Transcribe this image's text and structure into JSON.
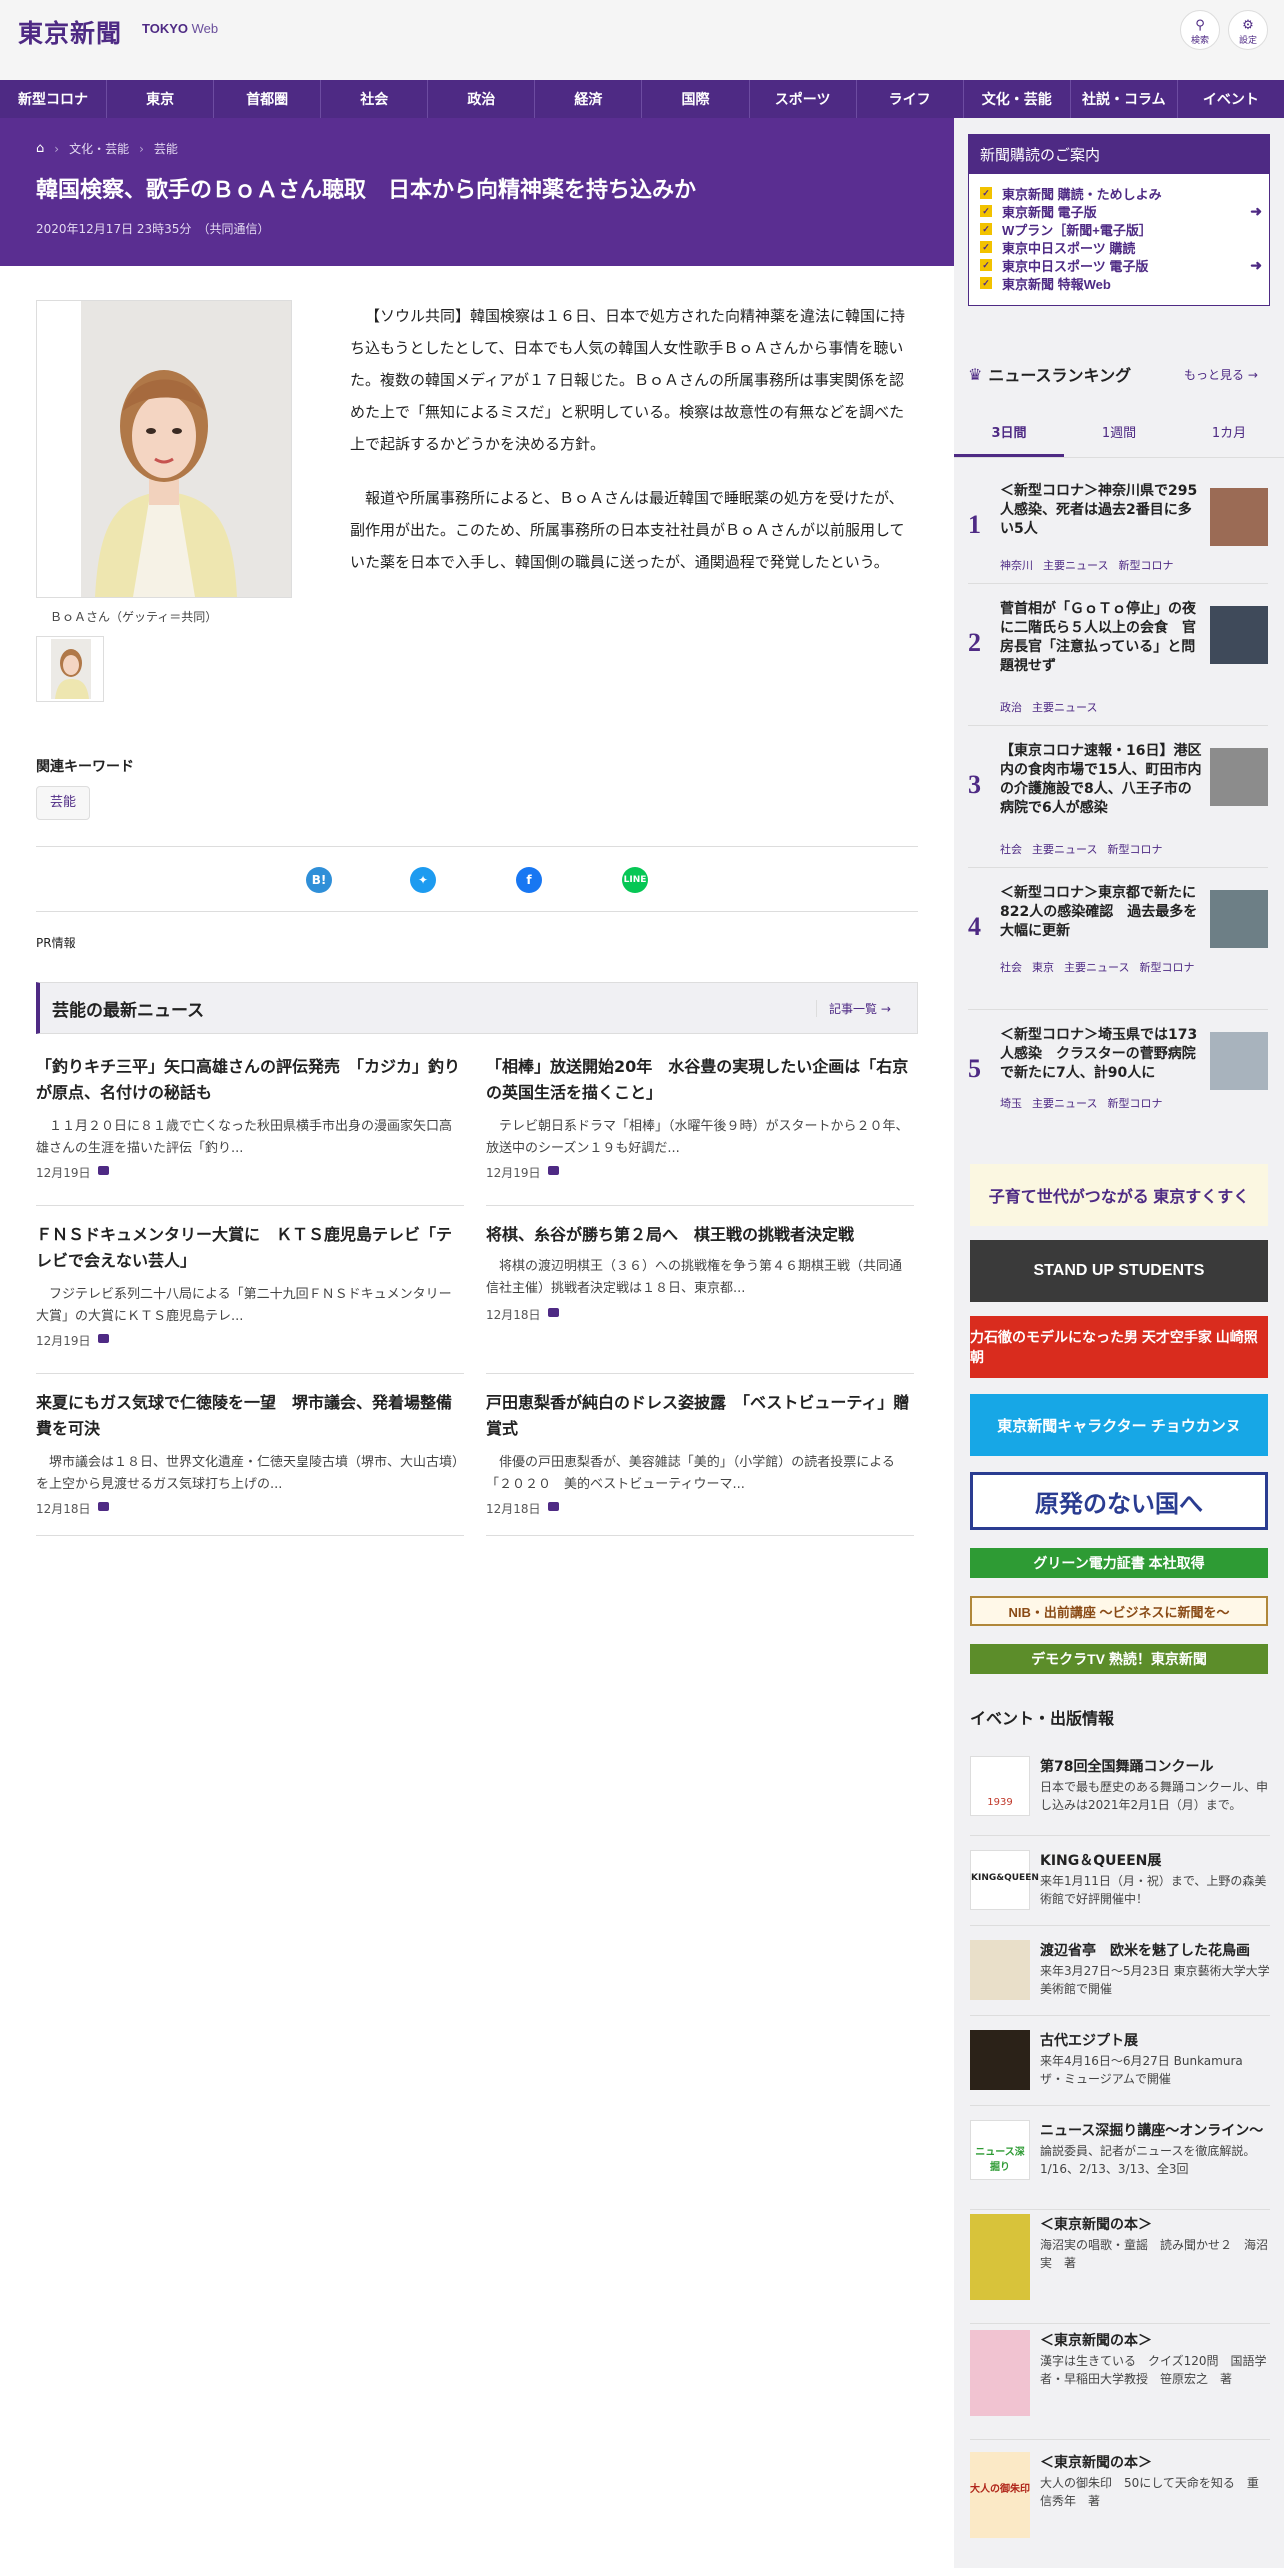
{
  "header": {
    "logo": "東京新聞",
    "logo_sub_a": "TOKYO",
    "logo_sub_b": "Web",
    "search_label": "検索",
    "settings_label": "設定"
  },
  "nav": [
    "新型コロナ",
    "東京",
    "首都圏",
    "社会",
    "政治",
    "経済",
    "国際",
    "スポーツ",
    "ライフ",
    "文化・芸能",
    "社説・コラム",
    "イベント"
  ],
  "breadcrumb": [
    "文化・芸能",
    "芸能"
  ],
  "article": {
    "title": "韓国検察、歌手のＢｏＡさん聴取　日本から向精神薬を持ち込みか",
    "date": "2020年12月17日 23時35分",
    "source": "（共同通信）",
    "photo_caption": "ＢｏＡさん（ゲッティ＝共同）",
    "paragraphs": [
      "【ソウル共同】韓国検察は１６日、日本で処方された向精神薬を違法に韓国に持ち込もうとしたとして、日本でも人気の韓国人女性歌手ＢｏＡさんから事情を聴いた。複数の韓国メディアが１７日報じた。ＢｏＡさんの所属事務所は事実関係を認めた上で「無知によるミスだ」と釈明している。検察は故意性の有無などを調べた上で起訴するかどうかを決める方針。",
      "報道や所属事務所によると、ＢｏＡさんは最近韓国で睡眠薬の処方を受けたが、副作用が出た。このため、所属事務所の日本支社社員がＢｏＡさんが以前服用していた薬を日本で入手し、韓国側の職員に送ったが、通関過程で発覚したという。"
    ],
    "keywords_label": "関連キーワード",
    "keywords": [
      "芸能"
    ],
    "pr_label": "PR情報"
  },
  "latest": {
    "title": "芸能の最新ニュース",
    "more": "記事一覧",
    "items": [
      {
        "title": "「釣りキチ三平」矢口高雄さんの評伝発売　「カジカ」釣りが原点、名付けの秘話も",
        "desc": "１１月２０日に８１歳で亡くなった秋田県横手市出身の漫画家矢口高雄さんの生涯を描いた評伝「釣り...",
        "date": "12月19日"
      },
      {
        "title": "「相棒」放送開始20年　水谷豊の実現したい企画は「右京の英国生活を描くこと」",
        "desc": "テレビ朝日系ドラマ「相棒」（水曜午後９時）がスタートから２０年、放送中のシーズン１９も好調だ...",
        "date": "12月19日"
      },
      {
        "title": "ＦＮＳドキュメンタリー大賞に　ＫＴＳ鹿児島テレビ「テレビで会えない芸人」",
        "desc": "フジテレビ系列二十八局による「第二十九回ＦＮＳドキュメンタリー大賞」の大賞にＫＴＳ鹿児島テレ...",
        "date": "12月19日"
      },
      {
        "title": "将棋、糸谷が勝ち第２局へ　棋王戦の挑戦者決定戦",
        "desc": "将棋の渡辺明棋王（３６）への挑戦権を争う第４６期棋王戦（共同通信社主催）挑戦者決定戦は１８日、東京都...",
        "date": "12月18日"
      },
      {
        "title": "来夏にもガス気球で仁徳陵を一望　堺市議会、発着場整備費を可決",
        "desc": "堺市議会は１８日、世界文化遺産・仁徳天皇陵古墳（堺市、大山古墳）を上空から見渡せるガス気球打ち上げの...",
        "date": "12月18日"
      },
      {
        "title": "戸田恵梨香が純白のドレス姿披露　「ベストビューティ」贈賞式",
        "desc": "俳優の戸田恵梨香が、美容雑誌「美的」（小学館）の読者投票による「２０２０　美的ベストビューティウーマ...",
        "date": "12月18日"
      }
    ]
  },
  "subscription": {
    "title": "新聞購読のご案内",
    "items": [
      {
        "label": "東京新聞 購読・ためしよみ",
        "arrow": false
      },
      {
        "label": "東京新聞 電子版",
        "arrow": true
      },
      {
        "label": "Wプラン［新聞+電子版］",
        "arrow": false
      },
      {
        "label": "東京中日スポーツ 購読",
        "arrow": false
      },
      {
        "label": "東京中日スポーツ 電子版",
        "arrow": true
      },
      {
        "label": "東京新聞 特報Web",
        "arrow": false
      }
    ]
  },
  "ranking": {
    "title": "ニュースランキング",
    "more": "もっと見る",
    "tabs": [
      "3日間",
      "1週間",
      "1カ月"
    ],
    "items": [
      {
        "num": "1",
        "title": "＜新型コロナ＞神奈川県で295人感染、死者は過去2番目に多い5人",
        "tags": [
          "神奈川",
          "主要ニュース",
          "新型コロナ"
        ]
      },
      {
        "num": "2",
        "title": "菅首相が「ＧｏＴｏ停止」の夜に二階氏ら５人以上の会食　官房長官「注意払っている」と問題視せず",
        "tags": [
          "政治",
          "主要ニュース"
        ]
      },
      {
        "num": "3",
        "title": "【東京コロナ速報・16日】港区内の食肉市場で15人、町田市内の介護施設で8人、八王子市の病院で6人が感染",
        "tags": [
          "社会",
          "主要ニュース",
          "新型コロナ"
        ]
      },
      {
        "num": "4",
        "title": "＜新型コロナ＞東京都で新たに822人の感染確認　過去最多を大幅に更新",
        "tags": [
          "社会",
          "東京",
          "主要ニュース",
          "新型コロナ"
        ]
      },
      {
        "num": "5",
        "title": "＜新型コロナ＞埼玉県では173人感染　クラスターの菅野病院で新たに7人、計90人に",
        "tags": [
          "埼玉",
          "主要ニュース",
          "新型コロナ"
        ]
      }
    ]
  },
  "banners": [
    {
      "text": "子育て世代がつながる 東京すくすく"
    },
    {
      "text": "STAND UP STUDENTS"
    },
    {
      "text": "力石徹のモデルになった男 天才空手家 山崎照朝"
    },
    {
      "text": "東京新聞キャラクター チョウカンヌ"
    },
    {
      "text": "原発のない国へ"
    },
    {
      "text": "グリーン電力証書 本社取得"
    },
    {
      "text": "NIB・出前講座 ～ビジネスに新聞を～"
    },
    {
      "text": "デモクラTV 熟読！東京新聞"
    }
  ],
  "events": {
    "title": "イベント・出版情報",
    "items": [
      {
        "title": "第78回全国舞踊コンクール",
        "desc": "日本で最も歴史のある舞踊コンクール、申し込みは2021年2月1日（月）まで。",
        "thumb": "1939"
      },
      {
        "title": "KING＆QUEEN展",
        "desc": "来年1月11日（月・祝）まで、上野の森美術館で好評開催中！",
        "thumb": "KING&QUEEN"
      },
      {
        "title": "渡辺省亭　欧米を魅了した花鳥画",
        "desc": "来年3月27日～5月23日 東京藝術大学大学美術館で開催",
        "thumb": ""
      },
      {
        "title": "古代エジプト展",
        "desc": "来年4月16日～6月27日 Bunkamura ザ・ミュージアムで開催",
        "thumb": ""
      },
      {
        "title": "ニュース深掘り講座～オンライン～",
        "desc": "論説委員、記者がニュースを徹底解説。1/16、2/13、3/13、全3回",
        "thumb": "ニュース深掘り"
      },
      {
        "title": "＜東京新聞の本＞",
        "desc": "海沼実の唱歌・童謡　読み聞かせ２　海沼実　著",
        "thumb": ""
      },
      {
        "title": "＜東京新聞の本＞",
        "desc": "漢字は生きている　クイズ120問　国語学者・早稲田大学教授　笹原宏之　著",
        "thumb": ""
      },
      {
        "title": "＜東京新聞の本＞",
        "desc": "大人の御朱印　50にして天命を知る　重信秀年　著",
        "thumb": "大人の御朱印"
      }
    ]
  },
  "colors": {
    "brand": "#4e2a84",
    "band": "#5a2e91",
    "accent": "#f2c200"
  }
}
